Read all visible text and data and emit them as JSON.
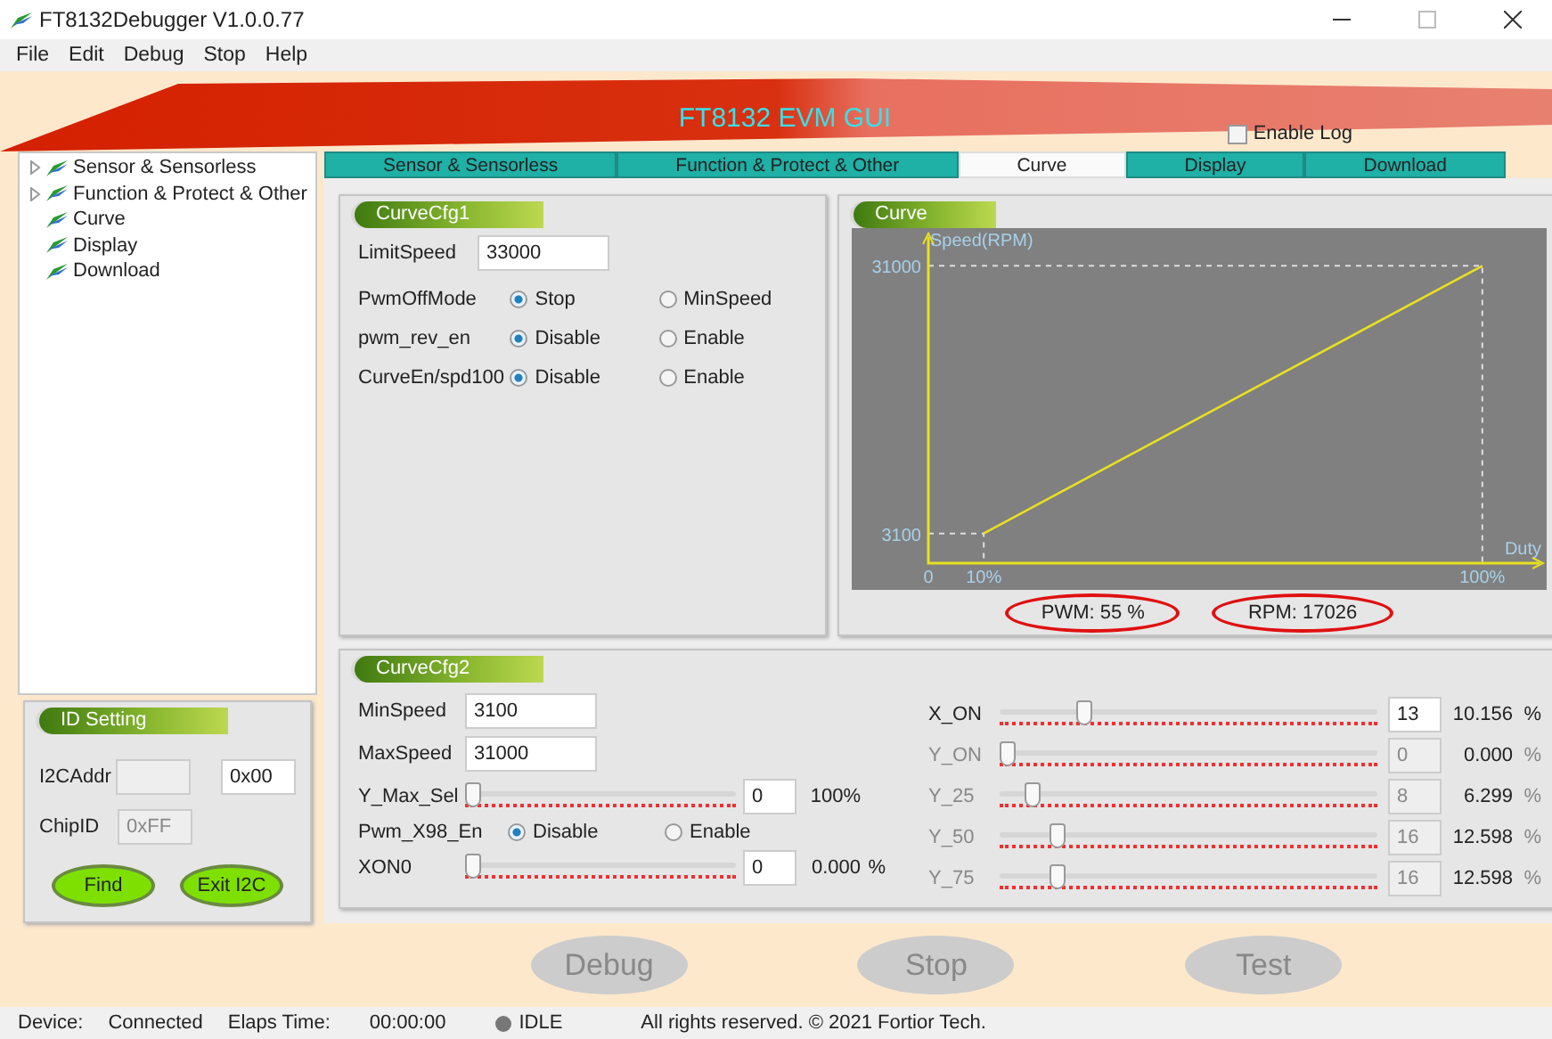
{
  "window": {
    "title": "FT8132Debugger V1.0.0.77"
  },
  "menu": [
    "File",
    "Edit",
    "Debug",
    "Stop",
    "Help"
  ],
  "banner": {
    "title": "FT8132 EVM GUI",
    "enable_log": {
      "label": "Enable Log",
      "checked": false
    }
  },
  "tree": [
    {
      "label": "Sensor & Sensorless",
      "expandable": true
    },
    {
      "label": "Function & Protect & Other",
      "expandable": true
    },
    {
      "label": "Curve",
      "expandable": false
    },
    {
      "label": "Display",
      "expandable": false
    },
    {
      "label": "Download",
      "expandable": false
    }
  ],
  "tabs": [
    {
      "label": "Sensor & Sensorless",
      "selected": false
    },
    {
      "label": "Function & Protect & Other",
      "selected": false
    },
    {
      "label": "Curve",
      "selected": true
    },
    {
      "label": "Display",
      "selected": false
    },
    {
      "label": "Download",
      "selected": false
    }
  ],
  "curve_cfg1": {
    "title": "CurveCfg1",
    "limit_speed": {
      "label": "LimitSpeed",
      "value": "33000"
    },
    "options": [
      {
        "label": "PwmOffMode",
        "choices": [
          {
            "label": "Stop",
            "selected": true
          },
          {
            "label": "MinSpeed",
            "selected": false
          }
        ]
      },
      {
        "label": "pwm_rev_en",
        "choices": [
          {
            "label": "Disable",
            "selected": true
          },
          {
            "label": "Enable",
            "selected": false
          }
        ]
      },
      {
        "label": "CurveEn/spd100",
        "choices": [
          {
            "label": "Disable",
            "selected": true
          },
          {
            "label": "Enable",
            "selected": false
          }
        ]
      }
    ]
  },
  "curve_panel": {
    "title": "Curve",
    "chart_data": {
      "type": "line",
      "xlabel": "Duty",
      "ylabel": "Speed(RPM)",
      "x": [
        10,
        100
      ],
      "series": [
        {
          "color": "#e8e020",
          "values": [
            3100,
            31000
          ]
        }
      ],
      "xlim": [
        0,
        110
      ],
      "ylim": [
        0,
        34000
      ],
      "xticks": [
        {
          "value": 0,
          "label": "0"
        },
        {
          "value": 10,
          "label": "10%"
        },
        {
          "value": 100,
          "label": "100%"
        }
      ],
      "yticks": [
        3100,
        31000
      ]
    },
    "readings": [
      "PWM: 55 %",
      "RPM: 17026"
    ]
  },
  "curve_cfg2": {
    "title": "CurveCfg2",
    "fields": [
      {
        "label": "MinSpeed",
        "value": "3100"
      },
      {
        "label": "MaxSpeed",
        "value": "31000"
      }
    ],
    "left_rows": [
      {
        "kind": "slider",
        "label": "Y_Max_Sel",
        "level": 0,
        "value": "0",
        "reading": "100%"
      },
      {
        "kind": "radio",
        "label": "Pwm_X98_En",
        "choices": [
          {
            "label": "Disable",
            "selected": true
          },
          {
            "label": "Enable",
            "selected": false
          }
        ]
      },
      {
        "kind": "slider",
        "label": "XON0",
        "level": 0,
        "value": "0",
        "reading": "0.000",
        "unit": "%"
      }
    ],
    "right_sliders": [
      {
        "label": "X_ON",
        "level": 0.21,
        "value": "13",
        "reading": "10.156",
        "unit": "%",
        "disabled": false
      },
      {
        "label": "Y_ON",
        "level": 0,
        "value": "0",
        "reading": "0.000",
        "unit": "%",
        "disabled": true
      },
      {
        "label": "Y_25",
        "level": 0.07,
        "value": "8",
        "reading": "6.299",
        "unit": "%",
        "disabled": true
      },
      {
        "label": "Y_50",
        "level": 0.14,
        "value": "16",
        "reading": "12.598",
        "unit": "%",
        "disabled": true
      },
      {
        "label": "Y_75",
        "level": 0.14,
        "value": "16",
        "reading": "12.598",
        "unit": "%",
        "disabled": true
      }
    ]
  },
  "id_setting": {
    "title": "ID Setting",
    "i2c_addr": {
      "label": "I2CAddr",
      "value": "0x00"
    },
    "chip_id": {
      "label": "ChipID",
      "value": "0xFF"
    },
    "buttons": [
      "Find",
      "Exit I2C"
    ]
  },
  "actions": [
    {
      "label": "Debug",
      "disabled": true
    },
    {
      "label": "Stop",
      "disabled": true
    },
    {
      "label": "Test",
      "disabled": true
    }
  ],
  "status": {
    "device_label": "Device:",
    "device": "Connected",
    "time_label": "Elaps Time:",
    "time": "00:00:00",
    "state": "IDLE",
    "copyright": "All rights reserved. © 2021 Fortior Tech."
  }
}
